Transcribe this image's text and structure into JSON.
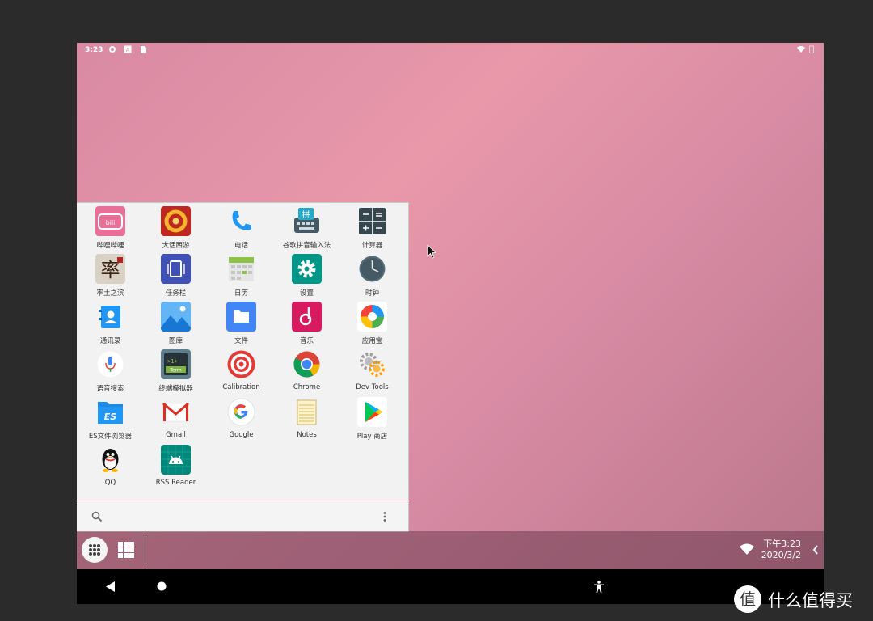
{
  "status_bar": {
    "time": "3:23"
  },
  "apps": [
    {
      "label": "哔哩哔哩",
      "icon": "bilibili-icon"
    },
    {
      "label": "大话西游",
      "icon": "dahuaxiyou-icon"
    },
    {
      "label": "电话",
      "icon": "phone-icon"
    },
    {
      "label": "谷歌拼音输入法",
      "icon": "google-pinyin-icon"
    },
    {
      "label": "计算器",
      "icon": "calculator-icon"
    },
    {
      "label": "率土之滨",
      "icon": "shuaituzhibin-icon"
    },
    {
      "label": "任务栏",
      "icon": "taskbar-icon"
    },
    {
      "label": "日历",
      "icon": "calendar-icon"
    },
    {
      "label": "设置",
      "icon": "settings-icon"
    },
    {
      "label": "时钟",
      "icon": "clock-icon"
    },
    {
      "label": "通讯录",
      "icon": "contacts-icon"
    },
    {
      "label": "图库",
      "icon": "gallery-icon"
    },
    {
      "label": "文件",
      "icon": "files-icon"
    },
    {
      "label": "音乐",
      "icon": "music-icon"
    },
    {
      "label": "应用宝",
      "icon": "yingyongbao-icon"
    },
    {
      "label": "语音搜索",
      "icon": "voice-search-icon"
    },
    {
      "label": "终端模拟器",
      "icon": "terminal-icon"
    },
    {
      "label": "Calibration",
      "icon": "calibration-icon"
    },
    {
      "label": "Chrome",
      "icon": "chrome-icon"
    },
    {
      "label": "Dev Tools",
      "icon": "dev-tools-icon"
    },
    {
      "label": "ES文件浏览器",
      "icon": "es-file-explorer-icon"
    },
    {
      "label": "Gmail",
      "icon": "gmail-icon"
    },
    {
      "label": "Google",
      "icon": "google-icon"
    },
    {
      "label": "Notes",
      "icon": "notes-icon"
    },
    {
      "label": "Play 商店",
      "icon": "play-store-icon"
    },
    {
      "label": "QQ",
      "icon": "qq-icon"
    },
    {
      "label": "RSS Reader",
      "icon": "rss-reader-icon"
    }
  ],
  "taskbar": {
    "time": "下午3:23",
    "date": "2020/3/2"
  },
  "watermark": {
    "text": "什么值得买",
    "logo_text": "值"
  },
  "colors": {
    "wallpaper": "#e898a9",
    "launcher_bg": "#f2f2f2",
    "navbar": "#000000"
  }
}
